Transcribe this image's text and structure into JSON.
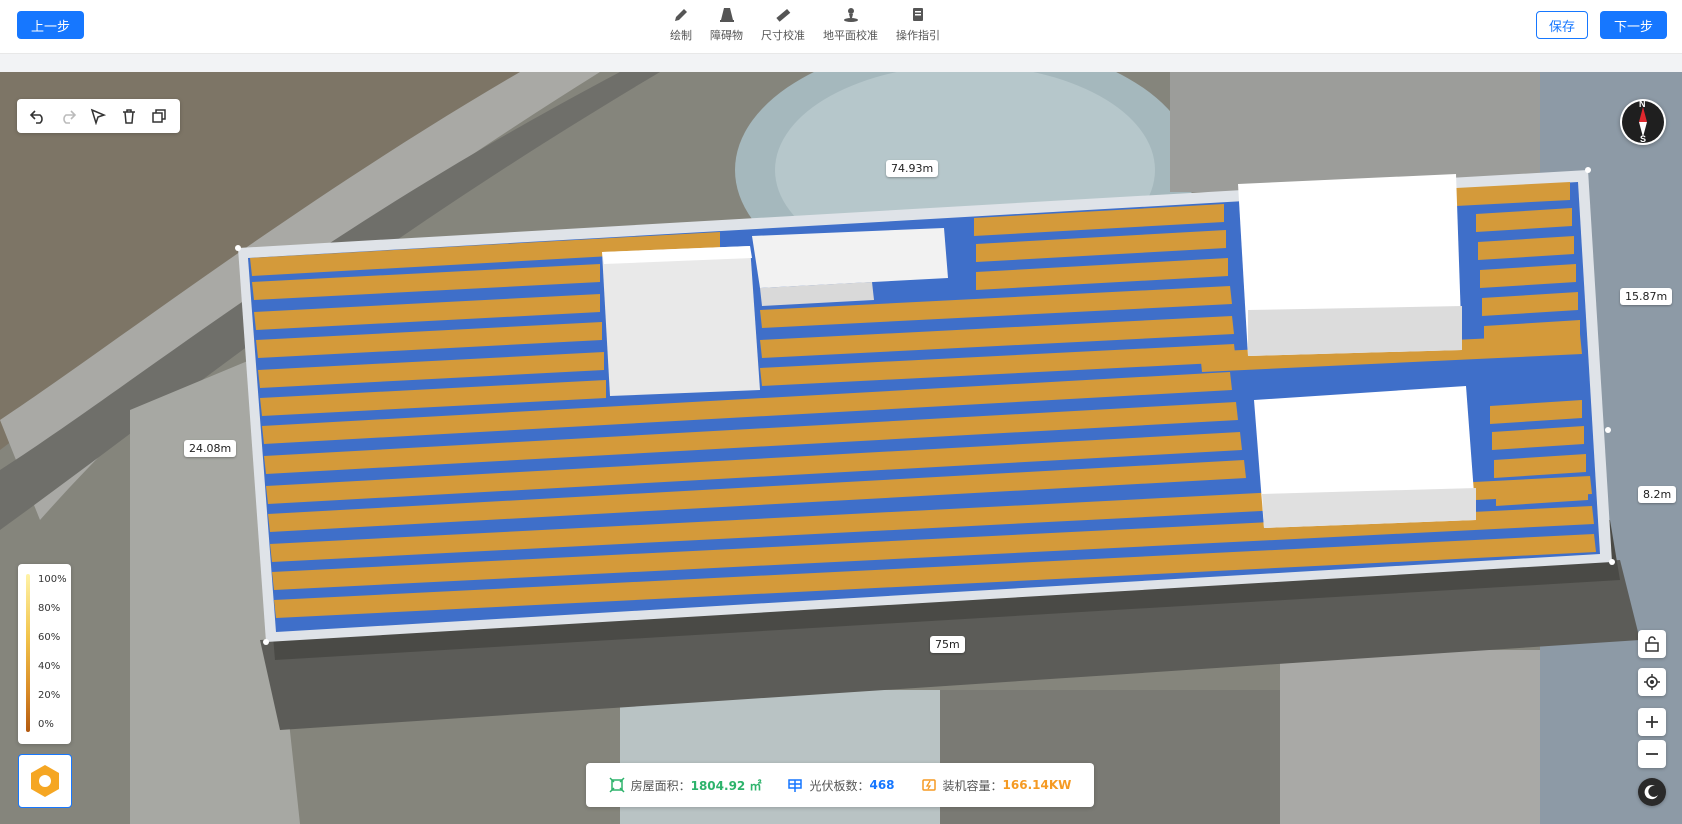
{
  "header": {
    "prev_label": "上一步",
    "save_label": "保存",
    "next_label": "下一步",
    "tools": [
      {
        "label": "绘制",
        "icon": "pen-icon"
      },
      {
        "label": "障碍物",
        "icon": "obstacle-icon"
      },
      {
        "label": "尺寸校准",
        "icon": "ruler-icon"
      },
      {
        "label": "地平面校准",
        "icon": "ground-plane-icon"
      },
      {
        "label": "操作指引",
        "icon": "guide-icon"
      }
    ]
  },
  "edit_toolbar": [
    "undo-icon",
    "redo-icon",
    "select-icon",
    "delete-icon",
    "copy-icon"
  ],
  "dimensions": {
    "top": "74.93m",
    "left": "24.08m",
    "right_upper": "15.87m",
    "right_lower": "8.2m",
    "bottom": "75m"
  },
  "compass": {
    "north": "N",
    "south": "S"
  },
  "legend": [
    "100%",
    "80%",
    "60%",
    "40%",
    "20%",
    "0%"
  ],
  "stats": {
    "area_label": "房屋面积：",
    "area_value": "1804.92 ㎡",
    "panels_label": "光伏板数：",
    "panels_value": "468",
    "capacity_label": "装机容量：",
    "capacity_value": "166.14KW"
  },
  "colors": {
    "accent": "#1677ff",
    "panel": "#d49a3a",
    "roof": "#3f6fc9",
    "area_value": "#2db36b",
    "panels_value": "#1677ff",
    "capacity_value": "#f59a23"
  }
}
